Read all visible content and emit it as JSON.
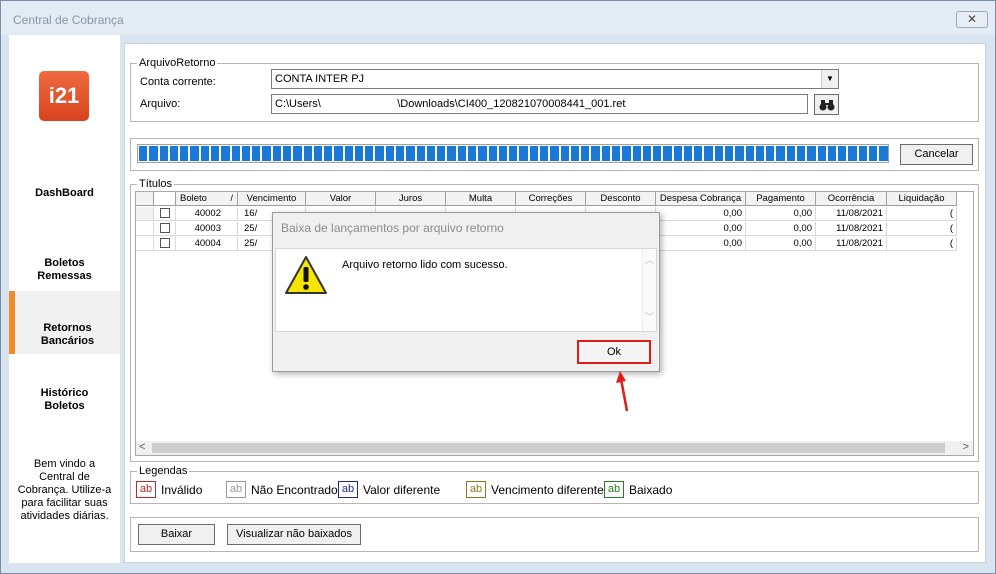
{
  "window": {
    "title": "Central de Cobrança",
    "close_label": "✕"
  },
  "sidebar": {
    "logo_text": "i21",
    "items": [
      {
        "label": "DashBoard"
      },
      {
        "label": "Boletos\nRemessas"
      },
      {
        "label": "Retornos\nBancários"
      },
      {
        "label": "Histórico\nBoletos"
      }
    ],
    "welcome": "Bem vindo a Central de Cobrança. Utilize-a para facilitar suas atividades diárias."
  },
  "arquivo_retorno": {
    "legend": "ArquivoRetorno",
    "conta_label": "Conta corrente:",
    "conta_value": "CONTA INTER PJ",
    "arquivo_label": "Arquivo:",
    "arquivo_value": "C:\\Users\\                         \\Downloads\\CI400_120821070008441_001.ret"
  },
  "progress": {
    "cancel_label": "Cancelar",
    "fraction": 1.0
  },
  "titulos": {
    "legend": "Títulos",
    "columns": [
      "",
      "Boleto",
      "/",
      "Vencimento",
      "Valor",
      "Juros",
      "Multa",
      "Correções",
      "Desconto",
      "Despesa Cobrança",
      "Pagamento",
      "Ocorrência",
      "Liquidação"
    ],
    "rows": [
      {
        "boleto": "40002",
        "vencimento": "16/",
        "valor": "",
        "juros": "",
        "multa": "",
        "correcoes": "",
        "desconto": "",
        "despesa": "0,00",
        "pagamento": "0,00",
        "ocorrencia": "11/08/2021",
        "liquidacao": "("
      },
      {
        "boleto": "40003",
        "vencimento": "25/",
        "valor": "",
        "juros": "",
        "multa": "",
        "correcoes": "",
        "desconto": "",
        "despesa": "0,00",
        "pagamento": "0,00",
        "ocorrencia": "11/08/2021",
        "liquidacao": "("
      },
      {
        "boleto": "40004",
        "vencimento": "25/",
        "valor": "",
        "juros": "",
        "multa": "",
        "correcoes": "",
        "desconto": "",
        "despesa": "0,00",
        "pagamento": "0,00",
        "ocorrencia": "11/08/2021",
        "liquidacao": "("
      }
    ]
  },
  "legendas": {
    "legend": "Legendas",
    "items": [
      {
        "box": "ab",
        "label": "Inválido",
        "color": "#c0262e"
      },
      {
        "box": "ab",
        "label": "Não Encontrado",
        "color": "#9a9a9a"
      },
      {
        "box": "ab",
        "label": "Valor diferente",
        "color": "#1f2a8a"
      },
      {
        "box": "ab",
        "label": "Vencimento diferente",
        "color": "#8a7a1a"
      },
      {
        "box": "ab",
        "label": "Baixado",
        "color": "#2a7a2a"
      }
    ]
  },
  "actions": {
    "baixar_label": "Baixar",
    "visualizar_label": "Visualizar não baixados"
  },
  "dialog": {
    "title": "Baixa de lançamentos por arquivo retorno",
    "message": "Arquivo retorno lido com sucesso.",
    "ok_label": "Ok",
    "highlight_color": "#e11a1a"
  }
}
